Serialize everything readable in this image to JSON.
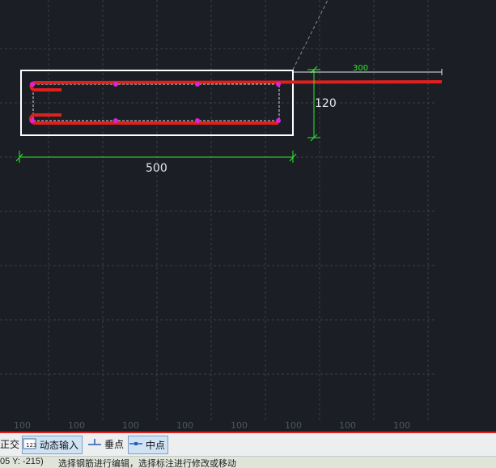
{
  "drawing": {
    "dim_width": "500",
    "dim_height": "120",
    "dim_extension": "300",
    "ruler_labels": [
      "100",
      "100",
      "100",
      "100",
      "100",
      "100",
      "100",
      "100"
    ]
  },
  "toolbar": {
    "ortho_label": "正交",
    "dynamic_input_label": "动态输入",
    "perpendicular_label": "垂点",
    "midpoint_label": "中点"
  },
  "status": {
    "coords": "05 Y: -215)",
    "message": "选择钢筋进行编辑，选择标注进行修改或移动"
  },
  "colors": {
    "background": "#1b1e24",
    "rebar": "#e0201c",
    "dimension": "#2fe82f",
    "node": "#e020e0"
  }
}
